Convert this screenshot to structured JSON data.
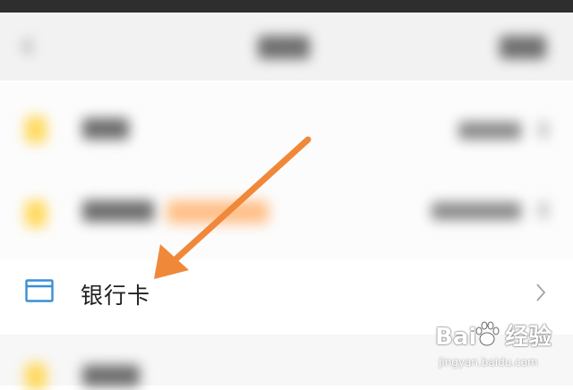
{
  "header": {
    "back_icon": "back-arrow-icon",
    "title_blurred": true,
    "right_action_blurred": true
  },
  "rows": [
    {
      "icon": "wallet-icon",
      "blurred": true
    },
    {
      "icon": "wallet-icon",
      "blurred": true,
      "tag_color": "#ffc089"
    },
    {
      "icon": "bank-card-icon",
      "label": "银行卡",
      "chevron": "chevron-right-icon"
    },
    {
      "icon": "wallet-icon",
      "blurred": true
    }
  ],
  "annotation": {
    "arrow_color": "#f0883a",
    "icon": "pointer-arrow-icon"
  },
  "watermark": {
    "brand_left": "Bai",
    "brand_right": "经验",
    "url": "jingyan.baidu.com",
    "icon": "baidu-paw-icon"
  },
  "colors": {
    "accent_blue": "#3a8fd4",
    "icon_yellow": "#ffd95c"
  }
}
